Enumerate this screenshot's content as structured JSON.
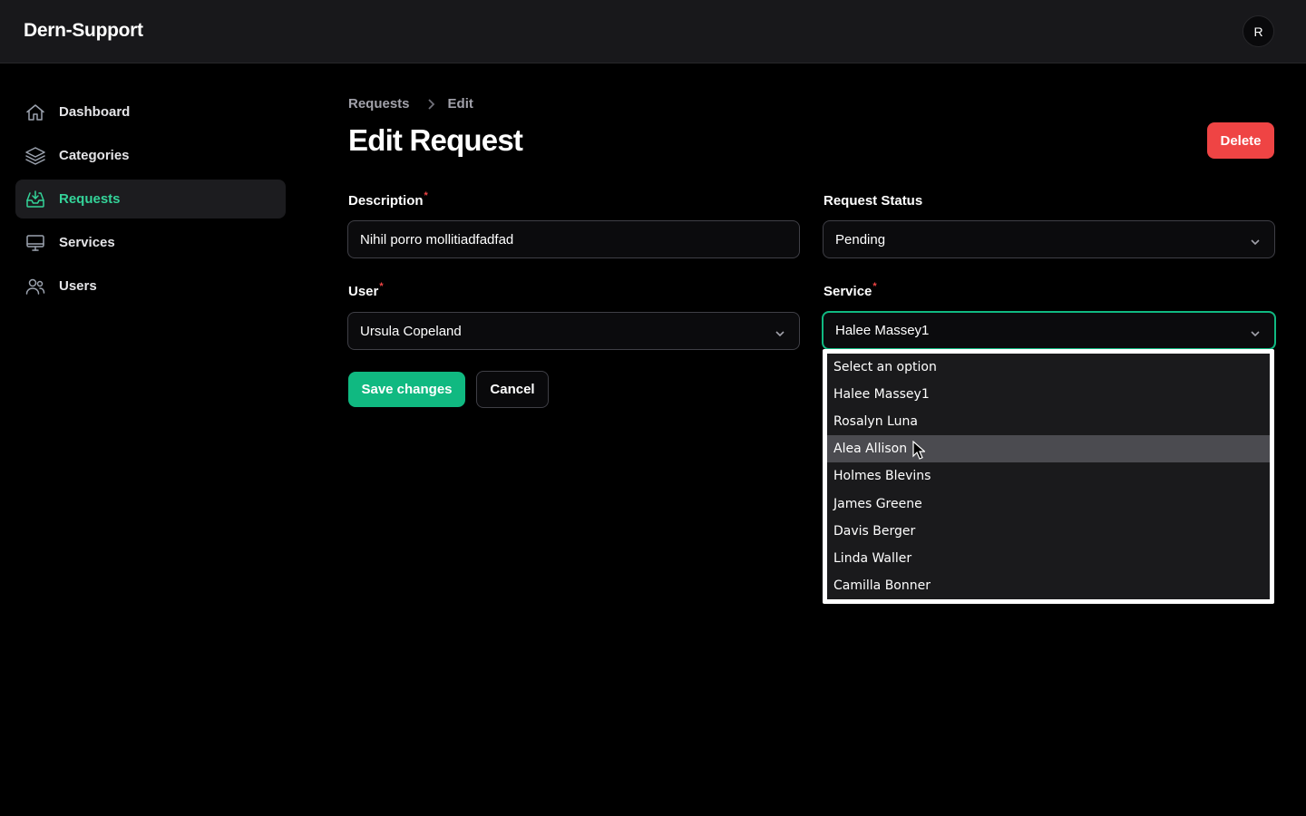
{
  "app": {
    "title": "Dern-Support",
    "avatar_initial": "R"
  },
  "sidebar": {
    "items": [
      {
        "label": "Dashboard",
        "icon": "home-icon",
        "active": false
      },
      {
        "label": "Categories",
        "icon": "layers-icon",
        "active": false
      },
      {
        "label": "Requests",
        "icon": "inbox-download-icon",
        "active": true
      },
      {
        "label": "Services",
        "icon": "monitor-icon",
        "active": false
      },
      {
        "label": "Users",
        "icon": "users-icon",
        "active": false
      }
    ]
  },
  "breadcrumb": {
    "parent": "Requests",
    "current": "Edit"
  },
  "page": {
    "title": "Edit Request",
    "delete_label": "Delete"
  },
  "form": {
    "description": {
      "label": "Description",
      "required": "*",
      "value": "Nihil porro mollitiadfadfad"
    },
    "status": {
      "label": "Request Status",
      "value": "Pending"
    },
    "user": {
      "label": "User",
      "required": "*",
      "value": "Ursula Copeland"
    },
    "service": {
      "label": "Service",
      "required": "*",
      "value": "Halee Massey1",
      "options": [
        "Select an option",
        "Halee Massey1",
        "Rosalyn Luna",
        "Alea Allison",
        "Holmes Blevins",
        "James Greene",
        "Davis Berger",
        "Linda Waller",
        "Camilla Bonner"
      ],
      "hovered_option": "Alea Allison"
    },
    "save_label": "Save changes",
    "cancel_label": "Cancel"
  },
  "colors": {
    "accent": "#10b981",
    "danger": "#ef4444",
    "background": "#000000",
    "surface": "#18181b"
  }
}
